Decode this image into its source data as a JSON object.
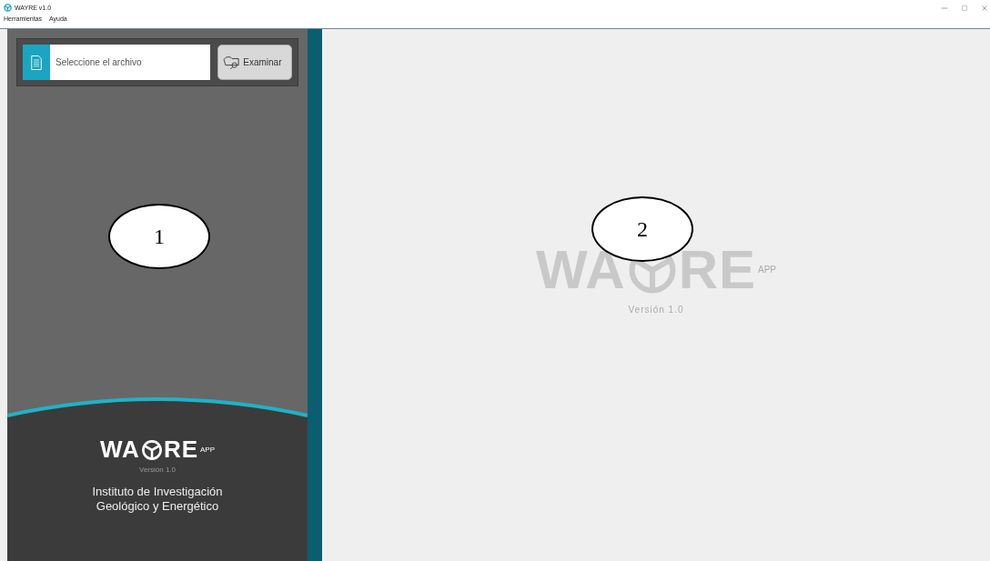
{
  "window": {
    "title": "WAYRE v1.0"
  },
  "menu": [
    "Herramientas",
    "Ayuda"
  ],
  "file_picker": {
    "placeholder": "Seleccione el archivo",
    "button": "Examinar"
  },
  "sidebar_logo": {
    "left": "WA",
    "right": "RE",
    "tag": "APP",
    "version": "Versión 1.0"
  },
  "institute": "Instituto de Investigación Geológico y Energético",
  "main_logo": {
    "left": "WA",
    "right": "RE",
    "tag": "APP",
    "version": "Versión 1.0"
  },
  "callouts": [
    {
      "label": "1"
    },
    {
      "label": "2"
    }
  ]
}
